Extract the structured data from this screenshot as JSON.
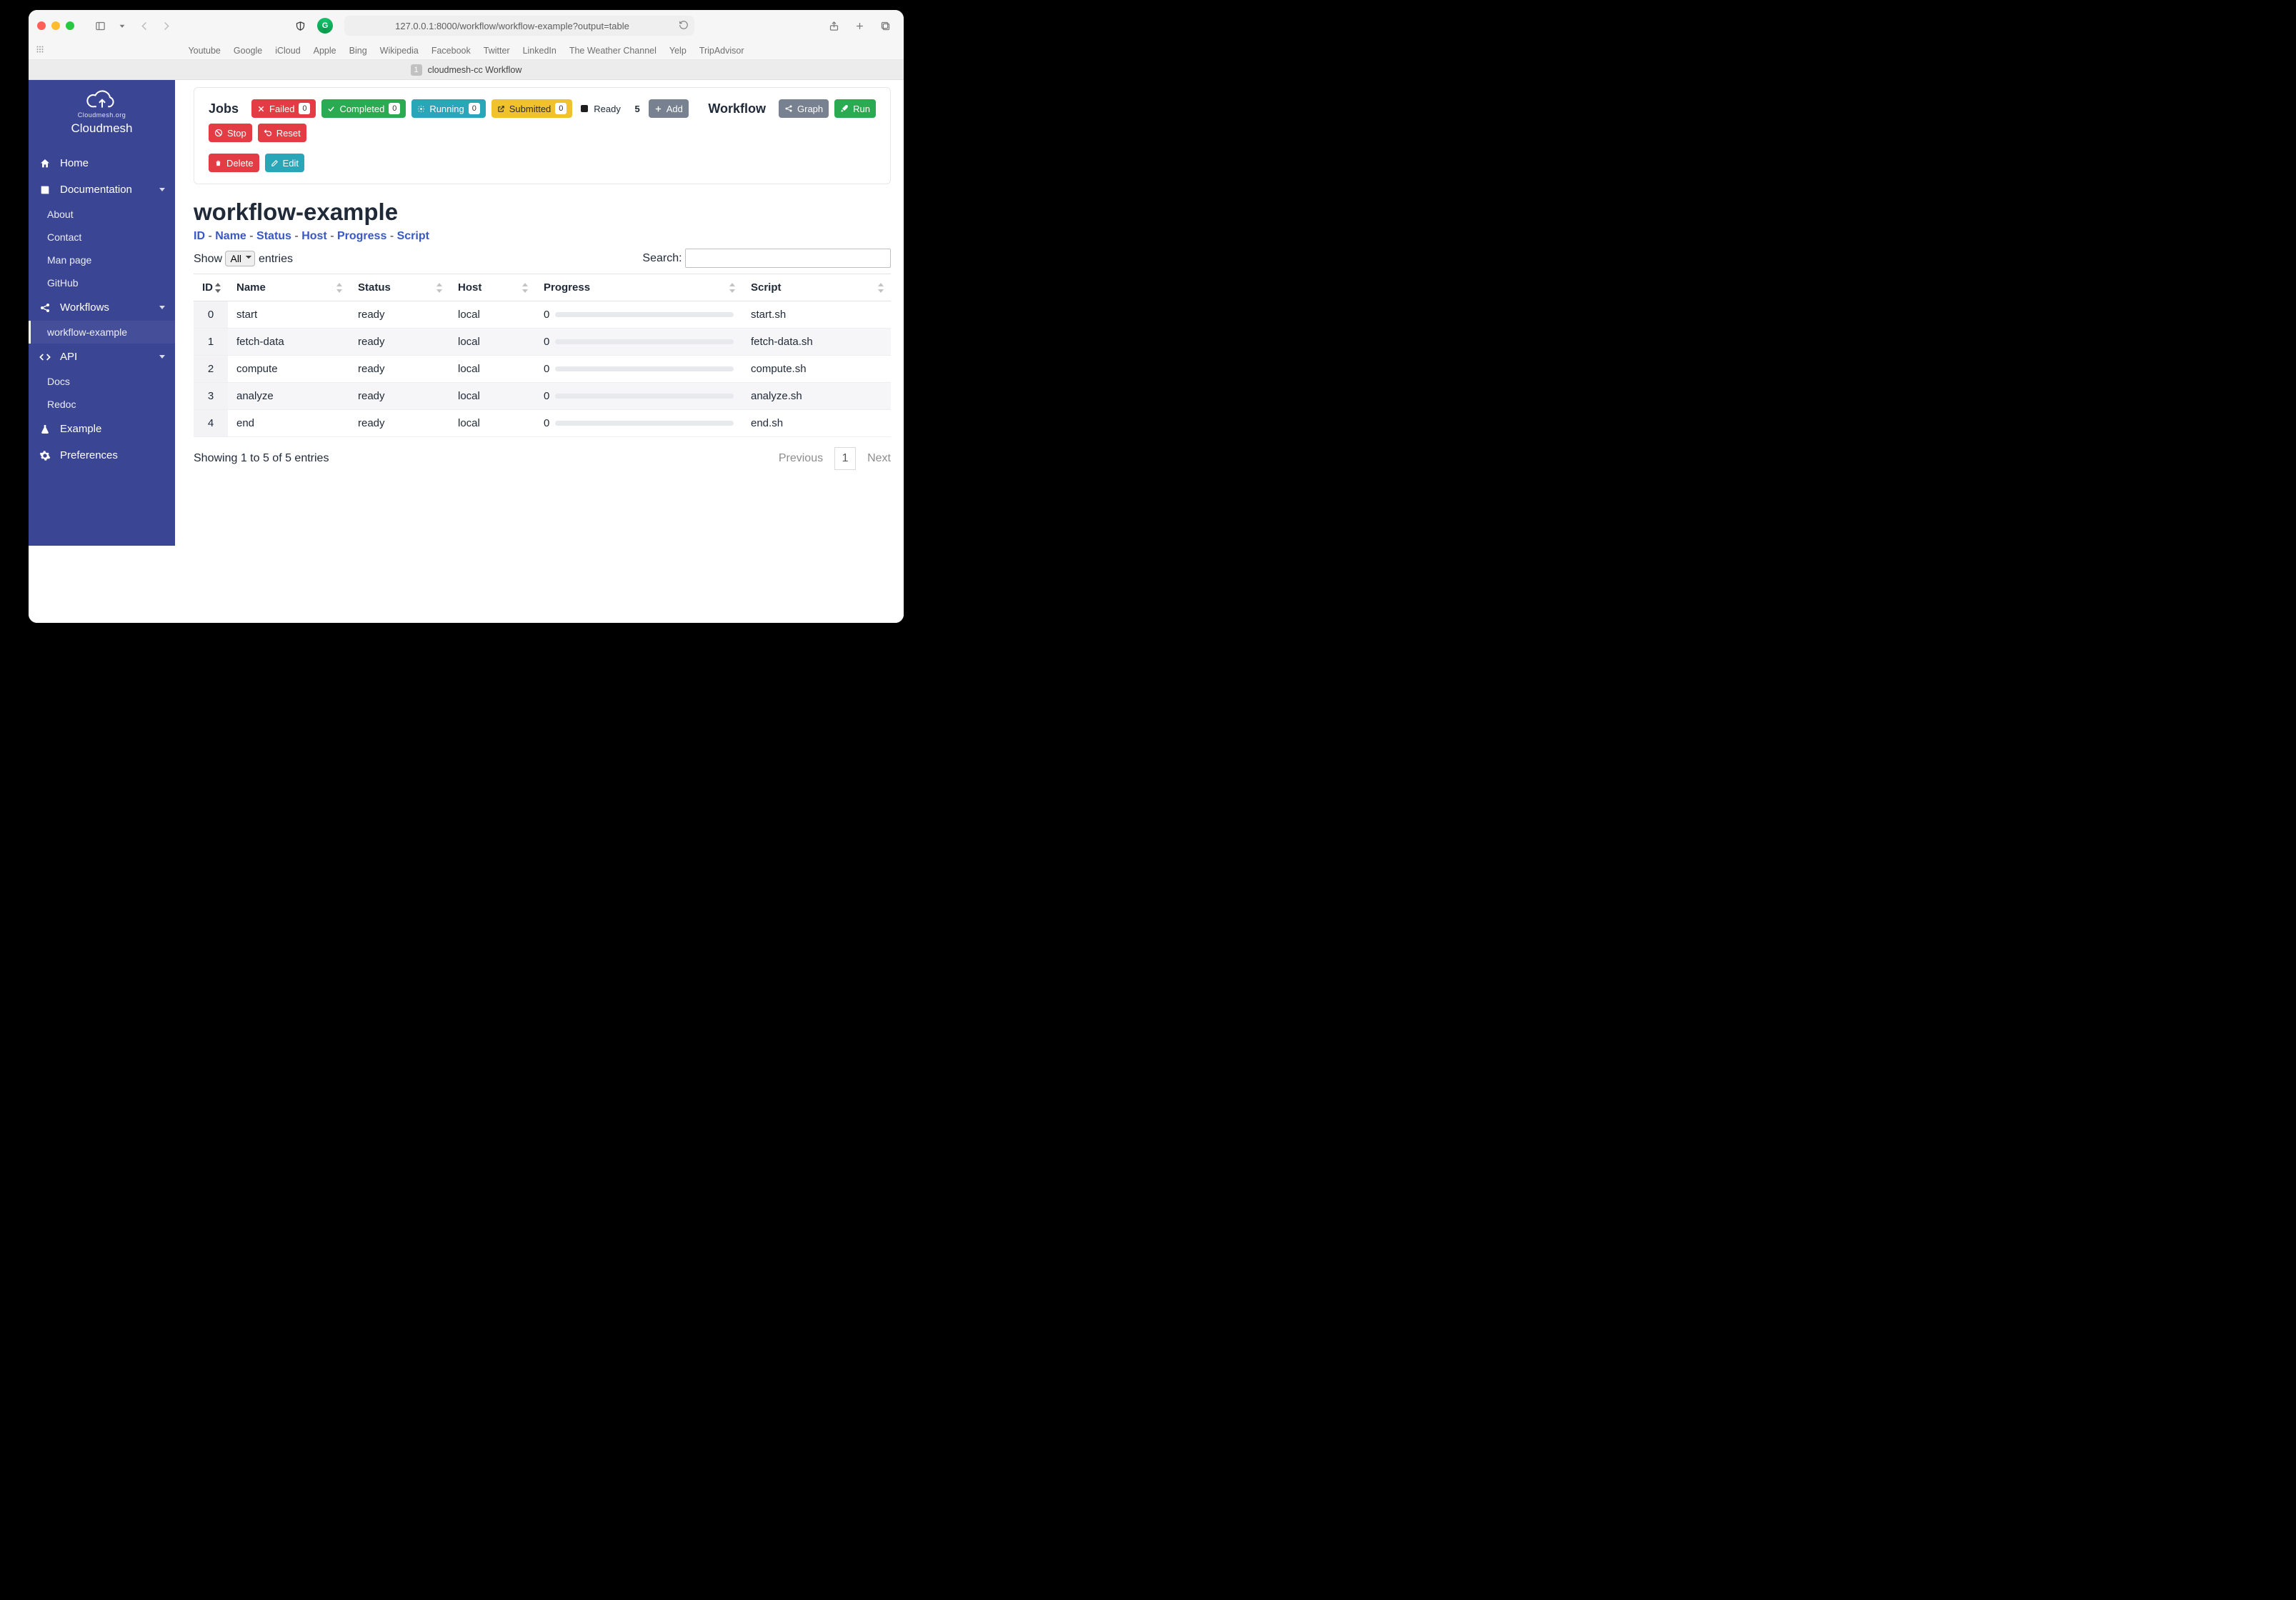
{
  "browser": {
    "url": "127.0.0.1:8000/workflow/workflow-example?output=table",
    "bookmarks": [
      "Youtube",
      "Google",
      "iCloud",
      "Apple",
      "Bing",
      "Wikipedia",
      "Facebook",
      "Twitter",
      "LinkedIn",
      "The Weather Channel",
      "Yelp",
      "TripAdvisor"
    ],
    "tab_badge": "1",
    "tab_title": "cloudmesh-cc Workflow"
  },
  "sidebar": {
    "org": "Cloudmesh.org",
    "title": "Cloudmesh",
    "home": "Home",
    "documentation": "Documentation",
    "doc_items": [
      "About",
      "Contact",
      "Man page",
      "GitHub"
    ],
    "workflows": "Workflows",
    "wf_items": [
      "workflow-example"
    ],
    "api": "API",
    "api_items": [
      "Docs",
      "Redoc"
    ],
    "example": "Example",
    "preferences": "Preferences"
  },
  "toolbar": {
    "jobs_title": "Jobs",
    "failed": "Failed",
    "failed_n": "0",
    "completed": "Completed",
    "completed_n": "0",
    "running": "Running",
    "running_n": "0",
    "submitted": "Submitted",
    "submitted_n": "0",
    "ready": "Ready",
    "ready_n": "5",
    "add": "Add",
    "delete": "Delete",
    "edit": "Edit",
    "workflow_title": "Workflow",
    "graph": "Graph",
    "run": "Run",
    "stop": "Stop",
    "reset": "Reset"
  },
  "page": {
    "heading": "workflow-example",
    "crumbs": [
      "ID",
      "Name",
      "Status",
      "Host",
      "Progress",
      "Script"
    ],
    "show": "Show",
    "show_val": "All",
    "entries": "entries",
    "search": "Search:",
    "info": "Showing 1 to 5 of 5 entries",
    "prev": "Previous",
    "page": "1",
    "next": "Next"
  },
  "columns": [
    "ID",
    "Name",
    "Status",
    "Host",
    "Progress",
    "Script"
  ],
  "rows": [
    {
      "id": "0",
      "name": "start",
      "status": "ready",
      "host": "local",
      "progress": "0",
      "script": "start.sh"
    },
    {
      "id": "1",
      "name": "fetch-data",
      "status": "ready",
      "host": "local",
      "progress": "0",
      "script": "fetch-data.sh"
    },
    {
      "id": "2",
      "name": "compute",
      "status": "ready",
      "host": "local",
      "progress": "0",
      "script": "compute.sh"
    },
    {
      "id": "3",
      "name": "analyze",
      "status": "ready",
      "host": "local",
      "progress": "0",
      "script": "analyze.sh"
    },
    {
      "id": "4",
      "name": "end",
      "status": "ready",
      "host": "local",
      "progress": "0",
      "script": "end.sh"
    }
  ]
}
